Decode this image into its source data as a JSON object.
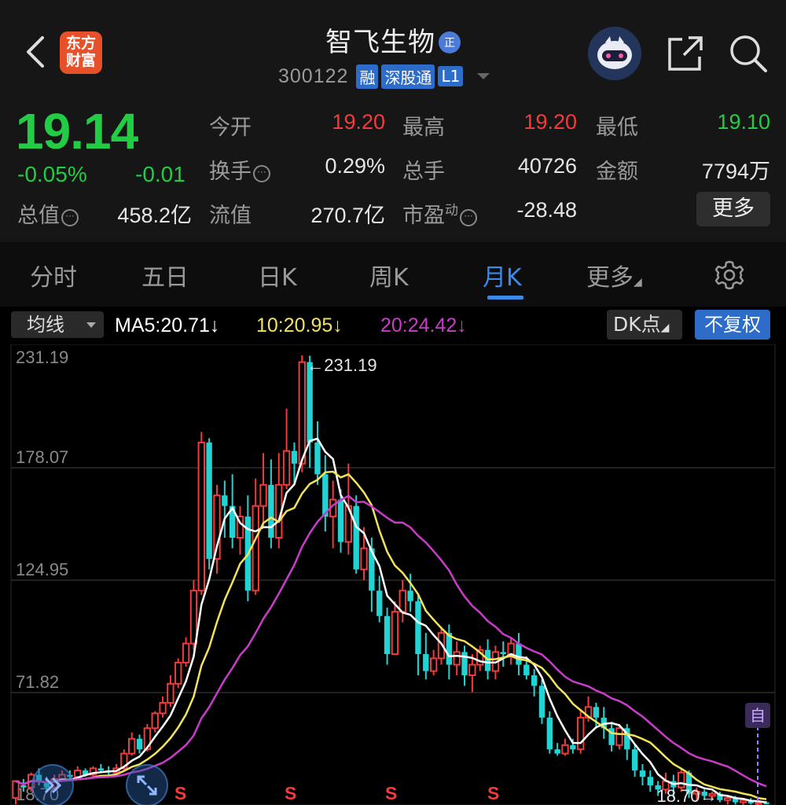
{
  "header": {
    "logo_text": "东方\n财富",
    "stock_name": "智飞生物",
    "zheng_badge": "正",
    "code": "300122",
    "tags": [
      "融",
      "深股通",
      "L1"
    ]
  },
  "quote": {
    "price": "19.14",
    "change_pct": "-0.05%",
    "change": "-0.01",
    "today_open_label": "今开",
    "today_open": "19.20",
    "high_label": "最高",
    "high": "19.20",
    "low_label": "最低",
    "low": "19.10",
    "turnover_label": "换手",
    "turnover": "0.29%",
    "volume_label": "总手",
    "volume": "40726",
    "amount_label": "金额",
    "amount": "7794万",
    "mktcap_label": "总值",
    "mktcap": "458.2亿",
    "float_label": "流值",
    "float_cap": "270.7亿",
    "pe_label": "市盈",
    "pe_sup": "动",
    "pe": "-28.48",
    "more_label": "更多"
  },
  "tabs": [
    "分时",
    "五日",
    "日K",
    "周K",
    "月K",
    "更多"
  ],
  "active_tab": "月K",
  "ma_bar": {
    "selector": "均线",
    "ma5": "MA5:20.71↓",
    "ma10": "10:20.95↓",
    "ma20": "20:24.42↓",
    "dk": "DK点",
    "fuquan": "不复权"
  },
  "colors": {
    "up": "#f03c3c",
    "down": "#22d3d3",
    "ma5": "#ffffff",
    "ma10": "#f2e35c",
    "ma20": "#c93cc9",
    "accent": "#3b8be6"
  },
  "chart_data": {
    "type": "candlestick",
    "y_ticks": [
      "231.19",
      "178.07",
      "124.95",
      "71.82",
      "18.70"
    ],
    "ylim": [
      18.7,
      231.19
    ],
    "max_annotation": "231.19",
    "min_annotation": "18.70",
    "signals": [
      "S",
      "S",
      "S",
      "S"
    ],
    "self_select_badge": "自",
    "candles": [
      [
        22,
        30,
        19,
        28
      ],
      [
        28,
        27,
        25,
        31
      ],
      [
        27,
        33,
        25,
        34
      ],
      [
        33,
        30,
        28,
        36
      ],
      [
        30,
        27,
        25,
        32
      ],
      [
        27,
        31,
        26,
        33
      ],
      [
        31,
        33,
        30,
        35
      ],
      [
        33,
        32,
        31,
        35
      ],
      [
        32,
        35,
        31,
        37
      ],
      [
        35,
        33,
        32,
        36
      ],
      [
        33,
        36,
        32,
        37
      ],
      [
        36,
        35,
        34,
        38
      ],
      [
        35,
        34,
        33,
        37
      ],
      [
        34,
        36,
        33,
        38
      ],
      [
        36,
        43,
        35,
        45
      ],
      [
        43,
        50,
        42,
        53
      ],
      [
        50,
        45,
        43,
        52
      ],
      [
        45,
        55,
        44,
        57
      ],
      [
        55,
        62,
        53,
        63
      ],
      [
        62,
        67,
        60,
        70
      ],
      [
        67,
        76,
        65,
        80
      ],
      [
        76,
        86,
        74,
        88
      ],
      [
        86,
        95,
        84,
        98
      ],
      [
        95,
        120,
        92,
        125
      ],
      [
        120,
        190,
        118,
        195
      ],
      [
        190,
        135,
        130,
        192
      ],
      [
        135,
        165,
        128,
        170
      ],
      [
        165,
        160,
        145,
        172
      ],
      [
        160,
        145,
        140,
        175
      ],
      [
        145,
        155,
        137,
        160
      ],
      [
        155,
        120,
        115,
        165
      ],
      [
        120,
        160,
        118,
        173
      ],
      [
        160,
        170,
        150,
        185
      ],
      [
        170,
        145,
        140,
        182
      ],
      [
        145,
        170,
        140,
        185
      ],
      [
        170,
        186,
        168,
        206
      ],
      [
        186,
        180,
        170,
        190
      ],
      [
        180,
        228,
        176,
        231.19
      ],
      [
        228,
        190,
        178,
        231
      ],
      [
        190,
        175,
        170,
        200
      ],
      [
        175,
        155,
        148,
        184
      ],
      [
        155,
        163,
        140,
        172
      ],
      [
        163,
        143,
        138,
        168
      ],
      [
        143,
        160,
        137,
        180
      ],
      [
        160,
        130,
        128,
        165
      ],
      [
        130,
        140,
        125,
        150
      ],
      [
        140,
        120,
        110,
        145
      ],
      [
        120,
        108,
        105,
        127
      ],
      [
        108,
        90,
        85,
        112
      ],
      [
        90,
        110,
        95,
        115
      ],
      [
        110,
        120,
        105,
        125
      ],
      [
        120,
        115,
        110,
        128
      ],
      [
        115,
        90,
        80,
        118
      ],
      [
        90,
        82,
        78,
        100
      ],
      [
        82,
        88,
        80,
        92
      ],
      [
        88,
        100,
        85,
        103
      ],
      [
        100,
        85,
        78,
        104
      ],
      [
        85,
        91,
        80,
        96
      ],
      [
        91,
        80,
        75,
        94
      ],
      [
        80,
        85,
        72,
        90
      ],
      [
        85,
        92,
        82,
        94
      ],
      [
        92,
        82,
        78,
        97
      ],
      [
        82,
        91,
        78,
        94
      ],
      [
        91,
        90,
        84,
        96
      ],
      [
        90,
        95,
        85,
        98
      ],
      [
        95,
        85,
        80,
        100
      ],
      [
        85,
        80,
        78,
        89
      ],
      [
        80,
        75,
        70,
        83
      ],
      [
        75,
        60,
        57,
        78
      ],
      [
        60,
        45,
        43,
        63
      ],
      [
        45,
        43,
        42,
        48
      ],
      [
        43,
        47,
        42,
        50
      ],
      [
        47,
        45,
        43,
        50
      ],
      [
        45,
        60,
        43,
        64
      ],
      [
        60,
        65,
        58,
        70
      ],
      [
        65,
        60,
        55,
        67
      ],
      [
        60,
        55,
        50,
        65
      ],
      [
        55,
        47,
        44,
        58
      ],
      [
        47,
        55,
        45,
        57
      ],
      [
        55,
        45,
        40,
        57
      ],
      [
        45,
        35,
        32,
        47
      ],
      [
        35,
        32,
        28,
        38
      ],
      [
        32,
        28,
        25,
        35
      ],
      [
        28,
        26,
        23,
        30
      ],
      [
        26,
        30,
        24,
        34
      ],
      [
        30,
        27,
        22,
        33
      ],
      [
        27,
        34,
        25,
        36
      ],
      [
        34,
        24,
        22,
        35
      ],
      [
        24,
        25,
        21,
        27
      ],
      [
        25,
        23,
        21,
        26
      ],
      [
        23,
        24,
        22,
        25
      ],
      [
        24,
        21,
        20,
        25
      ],
      [
        21,
        22,
        19,
        23
      ],
      [
        22,
        20,
        19,
        23
      ],
      [
        20,
        21,
        18.7,
        22
      ],
      [
        21,
        19.5,
        19,
        22
      ],
      [
        19.5,
        20,
        19,
        21
      ],
      [
        20,
        19.14,
        19.1,
        20.5
      ]
    ]
  }
}
